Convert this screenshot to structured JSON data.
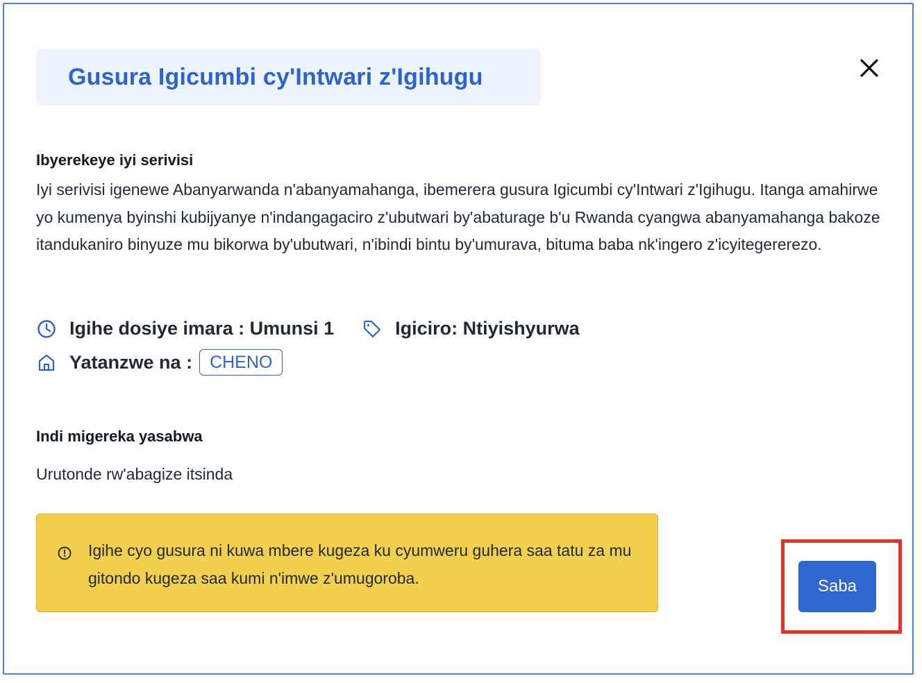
{
  "dialog": {
    "title": "Gusura Igicumbi cy'Intwari z'Igihugu",
    "close_icon": "close-icon"
  },
  "about": {
    "heading": "Ibyerekeye iyi serivisi",
    "description": "Iyi serivisi igenewe Abanyarwanda n'abanyamahanga, ibemerera gusura Igicumbi cy'Intwari z'Igihugu. Itanga amahirwe yo kumenya byinshi kubijyanye n'indangagaciro z'ubutwari by'abaturage b'u Rwanda cyangwa abanyamahanga bakoze itandukaniro binyuze mu bikorwa by'ubutwari, n'ibindi bintu by'umurava, bituma baba nk'ingero z'icyitegererezo."
  },
  "info": {
    "processing_time": "Igihe dosiye imara : Umunsi 1",
    "price": "Igiciro: Ntiyishyurwa",
    "provider_label": "Yatanzwe na :",
    "provider_name": "CHENO"
  },
  "requirements": {
    "heading": "Indi migereka yasabwa",
    "items": [
      "Urutonde rw'abagize itsinda"
    ]
  },
  "notice": {
    "text": "Igihe cyo gusura ni kuwa mbere kugeza ku cyumweru guhera saa tatu za mu gitondo kugeza saa kumi n'imwe z'umugoroba."
  },
  "actions": {
    "apply_label": "Saba"
  },
  "colors": {
    "accent": "#2f66cf",
    "title_bg": "#edf3fc",
    "notice_bg": "#f3cf4e",
    "highlight": "#e63125"
  }
}
